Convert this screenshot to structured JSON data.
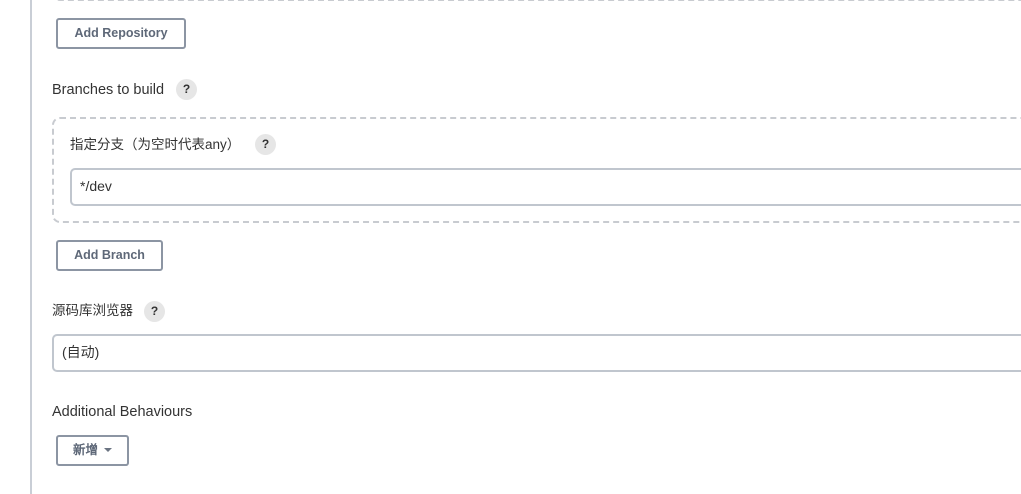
{
  "repositories": {
    "add_repository_label": "Add Repository"
  },
  "branches": {
    "section_label": "Branches to build",
    "help_label": "?",
    "branch_specifier_label": "指定分支（为空时代表any）",
    "branch_specifier_help": "?",
    "branch_specifier_value": "*/dev",
    "add_branch_label": "Add Branch"
  },
  "repository_browser": {
    "label": "源码库浏览器",
    "help_label": "?",
    "selected_value": "(自动)"
  },
  "additional_behaviours": {
    "label": "Additional Behaviours",
    "add_button_label": "新增"
  }
}
